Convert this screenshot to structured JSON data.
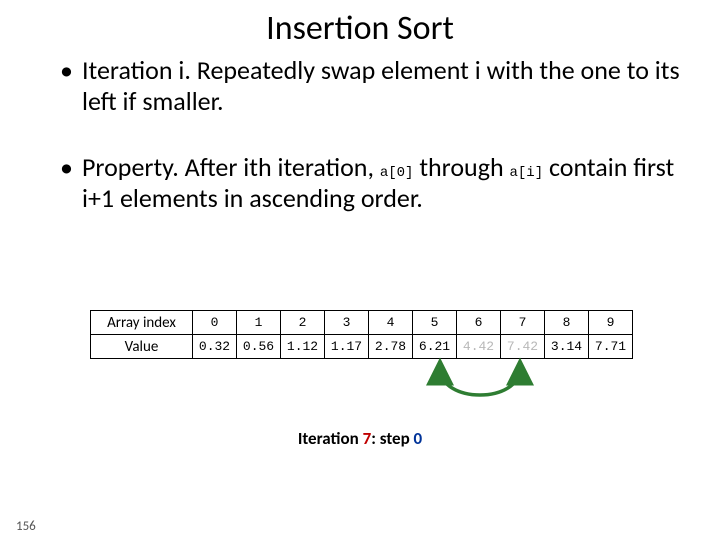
{
  "title": "Insertion Sort",
  "bullet1_a": "Iteration i.  Repeatedly swap element i with the one to its left if smaller.",
  "bullet2_a": "Property.  After ith iteration, ",
  "bullet2_code1": "a[0]",
  "bullet2_b": " through ",
  "bullet2_code2": "a[i]",
  "bullet2_c": " contain first i+1 elements in ascending order.",
  "row_label_index": "Array index",
  "row_label_value": "Value",
  "idx": [
    "0",
    "1",
    "2",
    "3",
    "4",
    "5",
    "6",
    "7",
    "8",
    "9"
  ],
  "val": [
    "0.32",
    "0.56",
    "1.12",
    "1.17",
    "2.78",
    "6.21",
    "4.42",
    "7.42",
    "3.14",
    "7.71"
  ],
  "iter_prefix": "Iteration ",
  "iter_num": "7",
  "iter_mid": ":  step ",
  "iter_step": "0",
  "page_num": "156",
  "chart_data": {
    "type": "table",
    "title": "Insertion Sort — Iteration 7, step 0",
    "columns": [
      "Array index",
      "0",
      "1",
      "2",
      "3",
      "4",
      "5",
      "6",
      "7",
      "8",
      "9"
    ],
    "rows": [
      {
        "label": "Value",
        "cells": [
          "0.32",
          "0.56",
          "1.12",
          "1.17",
          "2.78",
          "6.21",
          "4.42",
          "7.42",
          "3.14",
          "7.71"
        ]
      }
    ],
    "dimmed_columns": [
      6,
      7
    ],
    "swap_arrow_between_columns": [
      5,
      7
    ]
  }
}
